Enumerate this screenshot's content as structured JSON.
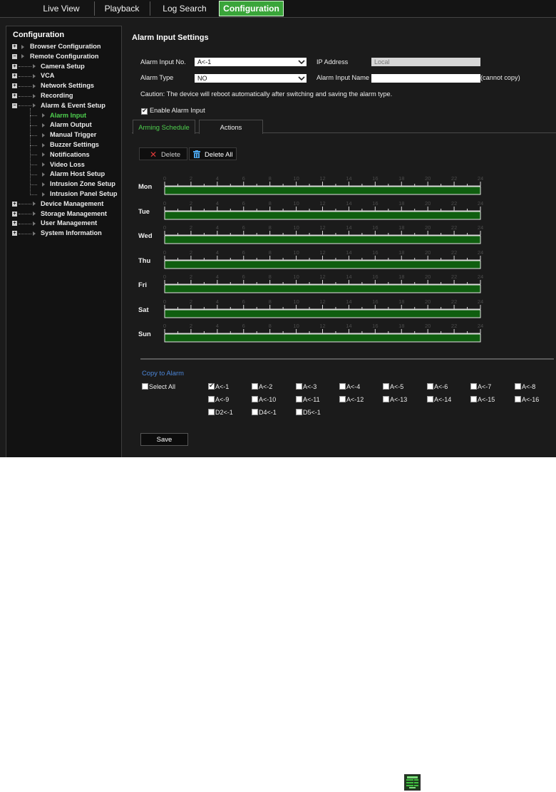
{
  "nav": {
    "tabs": [
      "Live View",
      "Playback",
      "Log Search",
      "Configuration"
    ],
    "active": "Configuration"
  },
  "sidebar": {
    "title": "Configuration",
    "items": [
      {
        "label": "Browser Configuration",
        "level": 0,
        "expander": "+"
      },
      {
        "label": "Remote Configuration",
        "level": 0,
        "expander": "-"
      },
      {
        "label": "Camera Setup",
        "level": 1,
        "expander": "+"
      },
      {
        "label": "VCA",
        "level": 1,
        "expander": "+"
      },
      {
        "label": "Network Settings",
        "level": 1,
        "expander": "+"
      },
      {
        "label": "Recording",
        "level": 1,
        "expander": "+"
      },
      {
        "label": "Alarm & Event Setup",
        "level": 1,
        "expander": "-"
      },
      {
        "label": "Alarm Input",
        "level": 2,
        "active": true
      },
      {
        "label": "Alarm Output",
        "level": 2
      },
      {
        "label": "Manual Trigger",
        "level": 2
      },
      {
        "label": "Buzzer Settings",
        "level": 2
      },
      {
        "label": "Notifications",
        "level": 2
      },
      {
        "label": "Video Loss",
        "level": 2
      },
      {
        "label": "Alarm Host Setup",
        "level": 2
      },
      {
        "label": "Intrusion Zone Setup",
        "level": 2
      },
      {
        "label": "Intrusion Panel Setup",
        "level": 2
      },
      {
        "label": "Device Management",
        "level": 1,
        "expander": "+"
      },
      {
        "label": "Storage Management",
        "level": 1,
        "expander": "+"
      },
      {
        "label": "User Management",
        "level": 1,
        "expander": "+"
      },
      {
        "label": "System Information",
        "level": 1,
        "expander": "+"
      }
    ]
  },
  "main": {
    "title": "Alarm Input Settings",
    "alarm_input_no": {
      "label": "Alarm Input No.",
      "value": "A<-1"
    },
    "ip_address": {
      "label": "IP Address",
      "value": "Local"
    },
    "alarm_type": {
      "label": "Alarm Type",
      "value": "NO"
    },
    "alarm_input_name": {
      "label": "Alarm Input Name",
      "value": "",
      "note": "(cannot copy)"
    },
    "caution": "Caution: The device will reboot automatically after switching and saving the alarm type.",
    "enable": {
      "label": "Enable Alarm Input",
      "checked": true
    },
    "tabs": [
      {
        "label": "Arming Schedule",
        "active": true
      },
      {
        "label": "Actions",
        "active": false
      }
    ],
    "buttons": {
      "delete": "Delete",
      "delete_all": "Delete All"
    },
    "schedule": {
      "days": [
        "Mon",
        "Tue",
        "Wed",
        "Thu",
        "Fri",
        "Sat",
        "Sun"
      ],
      "hour_ticks": [
        "0",
        "2",
        "4",
        "6",
        "8",
        "10",
        "12",
        "14",
        "16",
        "18",
        "20",
        "22",
        "24"
      ],
      "armed_hours": [
        0,
        24
      ]
    },
    "copy": {
      "title": "Copy to Alarm",
      "select_all": "Select All",
      "items": [
        {
          "label": "A<-1",
          "checked": true
        },
        {
          "label": "A<-2"
        },
        {
          "label": "A<-3"
        },
        {
          "label": "A<-4"
        },
        {
          "label": "A<-5"
        },
        {
          "label": "A<-6"
        },
        {
          "label": "A<-7"
        },
        {
          "label": "A<-8"
        },
        {
          "label": "A<-9"
        },
        {
          "label": "A<-10"
        },
        {
          "label": "A<-11"
        },
        {
          "label": "A<-12"
        },
        {
          "label": "A<-13"
        },
        {
          "label": "A<-14"
        },
        {
          "label": "A<-15"
        },
        {
          "label": "A<-16"
        },
        {
          "label": "D2<-1"
        },
        {
          "label": "D4<-1"
        },
        {
          "label": "D5<-1"
        }
      ]
    },
    "save": "Save"
  },
  "colors": {
    "accent": "#3aa53a",
    "schedule_fill": "#0f5e0f",
    "link_blue": "#4c86d8"
  }
}
